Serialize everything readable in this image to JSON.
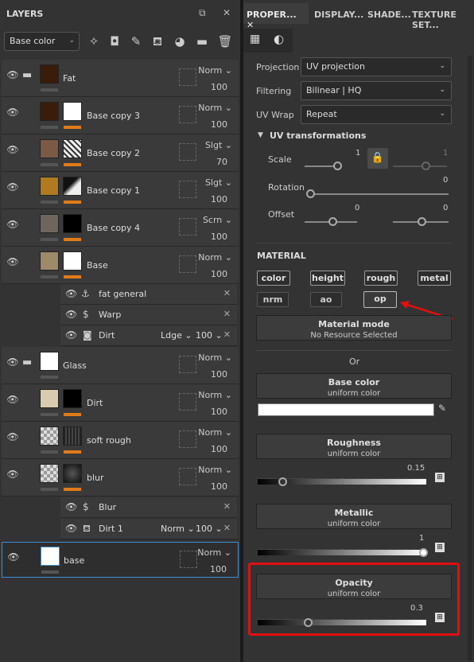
{
  "layers_panel": {
    "title": "LAYERS",
    "channel_select": "Base color",
    "layers": [
      {
        "name": "Fat",
        "blend": "Norm",
        "opacity": "100"
      },
      {
        "name": "Base copy 3",
        "blend": "Norm",
        "opacity": "100"
      },
      {
        "name": "Base copy 2",
        "blend": "Slgt",
        "opacity": "70"
      },
      {
        "name": "Base copy 1",
        "blend": "Slgt",
        "opacity": "100"
      },
      {
        "name": "Base copy 4",
        "blend": "Scrn",
        "opacity": "100"
      },
      {
        "name": "Base",
        "blend": "Norm",
        "opacity": "100"
      },
      {
        "name": "Glass",
        "blend": "Norm",
        "opacity": "100"
      },
      {
        "name": "Dirt",
        "blend": "Norm",
        "opacity": "100"
      },
      {
        "name": "soft rough",
        "blend": "Norm",
        "opacity": "100"
      },
      {
        "name": "blur",
        "blend": "Norm",
        "opacity": "100"
      },
      {
        "name": "base",
        "blend": "Norm",
        "opacity": "100"
      }
    ],
    "sub_items": [
      {
        "name": "fat general"
      },
      {
        "name": "Warp"
      },
      {
        "name": "Dirt",
        "blend": "Ldge",
        "opacity": "100"
      },
      {
        "name": "Blur"
      },
      {
        "name": "Dirt 1",
        "blend": "Norm",
        "opacity": "100"
      }
    ]
  },
  "tabs": [
    "PROPER...",
    "DISPLAY...",
    "SHADE...",
    "TEXTURE SET..."
  ],
  "properties": {
    "projection_label": "Projection",
    "projection_value": "UV projection",
    "filtering_label": "Filtering",
    "filtering_value": "Bilinear | HQ",
    "uvwrap_label": "UV Wrap",
    "uvwrap_value": "Repeat",
    "uv_transform_title": "UV transformations",
    "scale_label": "Scale",
    "scale_value_1": "1",
    "scale_value_2": "1",
    "rotation_label": "Rotation",
    "rotation_value": "0",
    "offset_label": "Offset",
    "offset_value_1": "0",
    "offset_value_2": "0",
    "material_title": "MATERIAL",
    "channels": [
      "color",
      "height",
      "rough",
      "metal",
      "nrm",
      "ao",
      "op"
    ],
    "material_mode_title": "Material mode",
    "material_mode_value": "No Resource Selected",
    "or_text": "Or",
    "base_color_title": "Base color",
    "base_color_sub": "uniform color",
    "roughness_title": "Roughness",
    "roughness_sub": "uniform color",
    "roughness_value": "0.15",
    "metallic_title": "Metallic",
    "metallic_sub": "uniform color",
    "metallic_value": "1",
    "opacity_title": "Opacity",
    "opacity_sub": "uniform color",
    "opacity_value": "0.3"
  },
  "colors": {
    "accent_orange": "#e07b1a",
    "highlight_red": "#e01010",
    "selection_blue": "#3d8fd1"
  }
}
